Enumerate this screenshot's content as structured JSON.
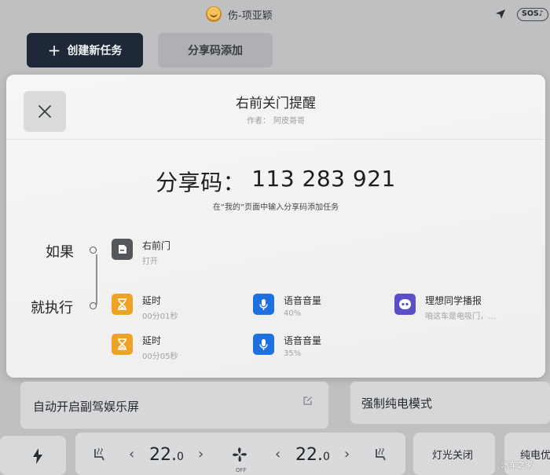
{
  "status_bar": {
    "user_name": "伤-项亚颖",
    "sos_label": "SOS♪"
  },
  "toolbar": {
    "create_plus": "+",
    "create_label": "创建新任务",
    "share_add_label": "分享码添加"
  },
  "modal": {
    "title": "右前关门提醒",
    "author_prefix": "作者：",
    "author_name": "阿皮哥哥",
    "share_code_label": "分享码：",
    "share_code": "113 283 921",
    "hint": "在“我的”页面中输入分享码添加任务",
    "condition_label": "如果",
    "action_label": "就执行",
    "condition": {
      "name": "右前门",
      "state": "打开"
    },
    "actions": [
      {
        "name": "延时",
        "detail": "00分01秒"
      },
      {
        "name": "语音音量",
        "detail": "40%"
      },
      {
        "name": "理想同学播报",
        "detail": "咱这车是电吸门，…"
      },
      {
        "name": "延时",
        "detail": "00分05秒"
      },
      {
        "name": "语音音量",
        "detail": "35%"
      }
    ]
  },
  "cards": {
    "passenger_screen": "自动开启副驾娱乐屏",
    "force_ev": "强制纯电模式"
  },
  "climate": {
    "left_temp": "22.",
    "left_temp_decimal": "0",
    "right_temp": "22.",
    "right_temp_decimal": "0",
    "fan_state": "OFF",
    "chev_left": "‹",
    "chev_right": "›"
  },
  "bottom": {
    "lights_off": "灯光关闭",
    "ev_partial": "纯电优"
  },
  "watermark": "汽车之家",
  "colors": {
    "primary_dark": "#1e2836",
    "delay_orange": "#efa326",
    "voice_blue": "#1e6fe0",
    "assistant_purple": "#5a4fc9"
  }
}
